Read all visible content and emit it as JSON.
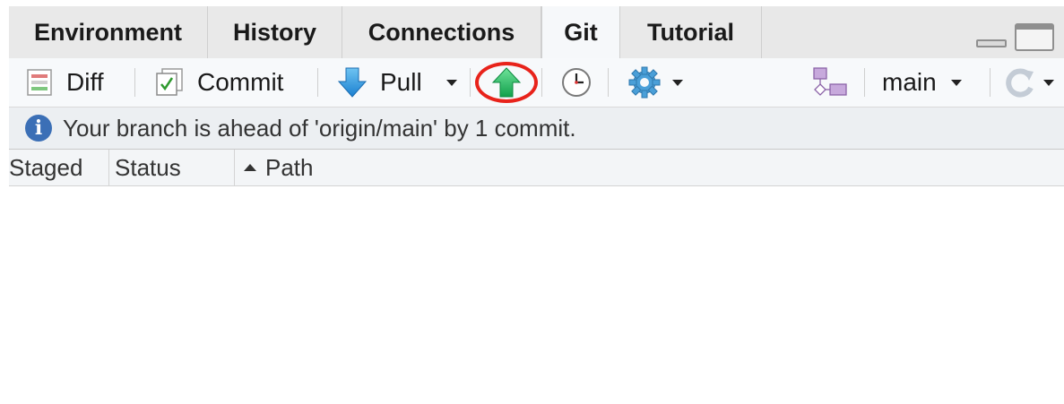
{
  "tabs": [
    {
      "label": "Environment"
    },
    {
      "label": "History"
    },
    {
      "label": "Connections"
    },
    {
      "label": "Git",
      "active": true
    },
    {
      "label": "Tutorial"
    }
  ],
  "toolbar": {
    "diff_label": "Diff",
    "commit_label": "Commit",
    "pull_label": "Pull",
    "branch_label": "main",
    "icons": [
      "diff-icon",
      "commit-checkbox-icon",
      "pull-arrow-icon",
      "push-arrow-icon",
      "history-clock-icon",
      "gear-icon",
      "new-branch-icon",
      "refresh-icon"
    ],
    "push_highlight_color": "#e8231b"
  },
  "info": {
    "message": "Your branch is ahead of 'origin/main' by 1 commit."
  },
  "table": {
    "columns": [
      "Staged",
      "Status",
      "Path"
    ],
    "sort_column": "Path",
    "rows": []
  }
}
